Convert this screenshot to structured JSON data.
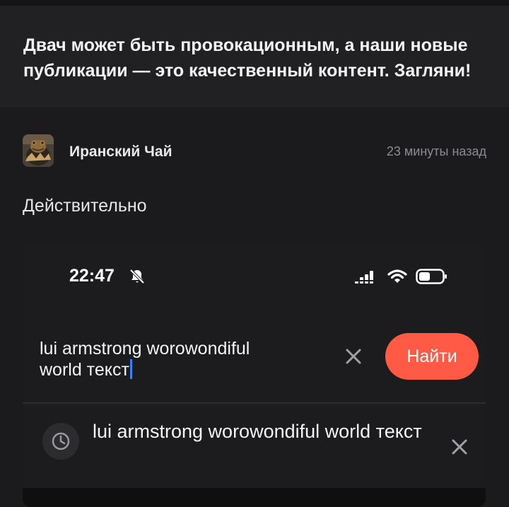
{
  "promo": {
    "text": "Двач может быть провокационным, а наши новые публикации — это качественный контент. Загляни!"
  },
  "post": {
    "author": "Иранский Чай",
    "time": "23 минуты назад",
    "text": "Действительно",
    "avatar_icon": "toad-avatar"
  },
  "screenshot": {
    "status_bar": {
      "time": "22:47",
      "icons": [
        "bell-slash-icon",
        "signal-icon",
        "wifi-icon",
        "battery-icon"
      ]
    },
    "search": {
      "query": "lui armstrong worowondiful world текст",
      "clear_icon": "close-icon",
      "button_label": "Найти",
      "button_color": "#ff5a45",
      "caret_color": "#3b82f6"
    },
    "history": {
      "item_text": "lui armstrong worowondiful world текст",
      "icon": "clock-icon",
      "remove_icon": "close-icon"
    }
  }
}
